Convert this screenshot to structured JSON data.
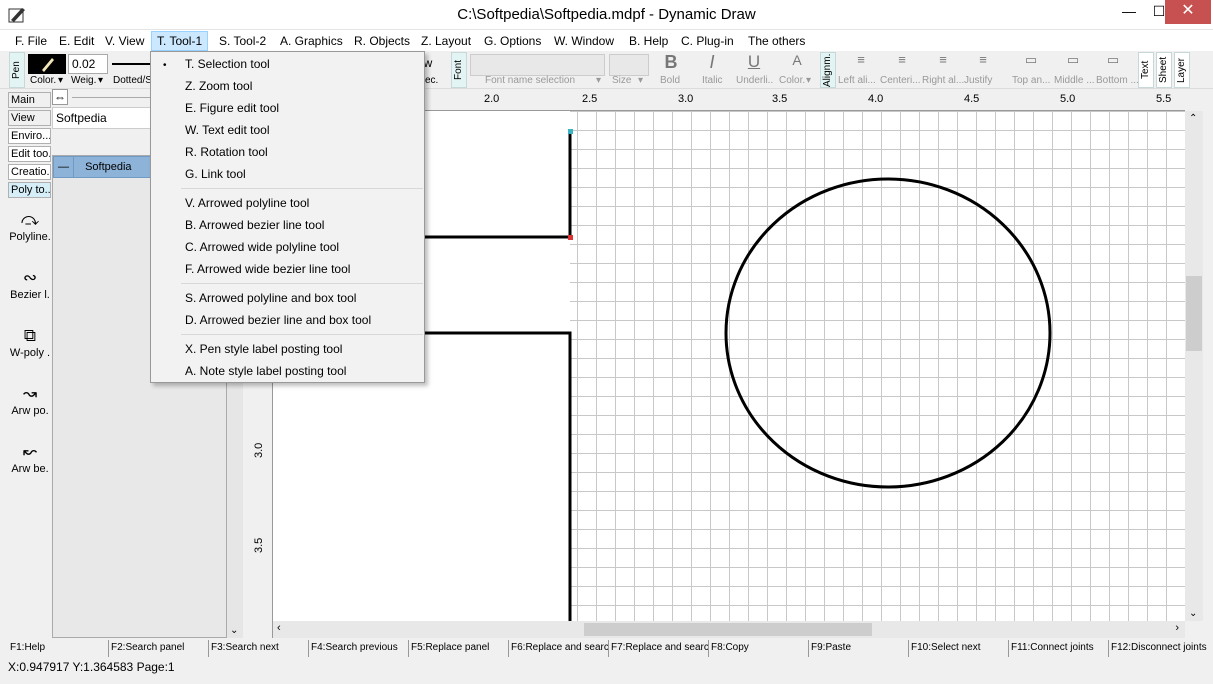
{
  "window": {
    "title": "C:\\Softpedia\\Softpedia.mdpf - Dynamic Draw",
    "minimize_label": "—",
    "maximize_label": "☐",
    "close_label": "✕"
  },
  "menubar": {
    "items": [
      "F. File",
      "E. Edit",
      "V. View",
      "T. Tool-1",
      "S. Tool-2",
      "A. Graphics",
      "R. Objects",
      "Z. Layout",
      "G. Options",
      "W. Window",
      "B. Help",
      "C. Plug-in",
      "The others"
    ]
  },
  "toolbar": {
    "pen_tab": "Pen",
    "color_label": "Color.",
    "weight_value": "0.02",
    "weight_label": "Weig.",
    "dotted_label": "Dotted/S",
    "arrow_value": "row",
    "spec_label": "ec.",
    "font_tab": "Font",
    "font_name_placeholder": "Font name selection",
    "size_label": "Size",
    "bold_label": "Bold",
    "italic_label": "Italic",
    "underline_label": "Underli..",
    "font_color_label": "Color.",
    "align_tab": "Alignm.",
    "align_items": [
      "Left ali...",
      "Centeri...",
      "Right al...",
      "Justify"
    ],
    "valign_items": [
      "Top an...",
      "Middle ...",
      "Bottom ..."
    ],
    "side_tabs": [
      "Text",
      "Sheet",
      "Layer"
    ]
  },
  "left_panel": {
    "tabs": [
      "Main",
      "View",
      "Enviro...",
      "Edit too.",
      "Creatio..",
      "Poly to.."
    ],
    "tools": [
      {
        "label": "Polyline.",
        "icon": "polyline-icon"
      },
      {
        "label": "Bezier l.",
        "icon": "bezier-icon"
      },
      {
        "label": "W-poly .",
        "icon": "wide-polyline-icon"
      },
      {
        "label": "Arw po.",
        "icon": "arrow-polyline-icon"
      },
      {
        "label": "Arw be.",
        "icon": "arrow-bezier-icon"
      }
    ]
  },
  "mid_panel": {
    "doc_name": "Softpedia",
    "layer_name": "Softpedia"
  },
  "ruler": {
    "top_ticks": [
      "2.0",
      "2.5",
      "3.0",
      "3.5",
      "4.0",
      "4.5",
      "5.0",
      "5.5"
    ],
    "left_ticks": [
      "3.0",
      "3.5"
    ]
  },
  "dropdown": {
    "group1": [
      "T. Selection tool",
      "Z. Zoom tool",
      "E. Figure edit tool",
      "W. Text edit tool",
      "R. Rotation tool",
      "G. Link tool"
    ],
    "group2": [
      "V. Arrowed polyline tool",
      "B. Arrowed bezier line tool",
      "C. Arrowed wide polyline tool",
      "F. Arrowed wide bezier line tool"
    ],
    "group3": [
      "S. Arrowed polyline and box tool",
      "D. Arrowed bezier line and box tool"
    ],
    "group4": [
      "X. Pen style label posting tool",
      "A. Note style label posting tool"
    ],
    "checked_bullet": "•"
  },
  "statusbar": {
    "fkeys": [
      "F1:Help",
      "F2:Search panel",
      "F3:Search next",
      "F4:Search previous",
      "F5:Replace panel",
      "F6:Replace and searc",
      "F7:Replace and searc",
      "F8:Copy",
      "F9:Paste",
      "F10:Select next",
      "F11:Connect joints",
      "F12:Disconnect joints"
    ],
    "coords": "X:0.947917 Y:1.364583 Page:1"
  }
}
